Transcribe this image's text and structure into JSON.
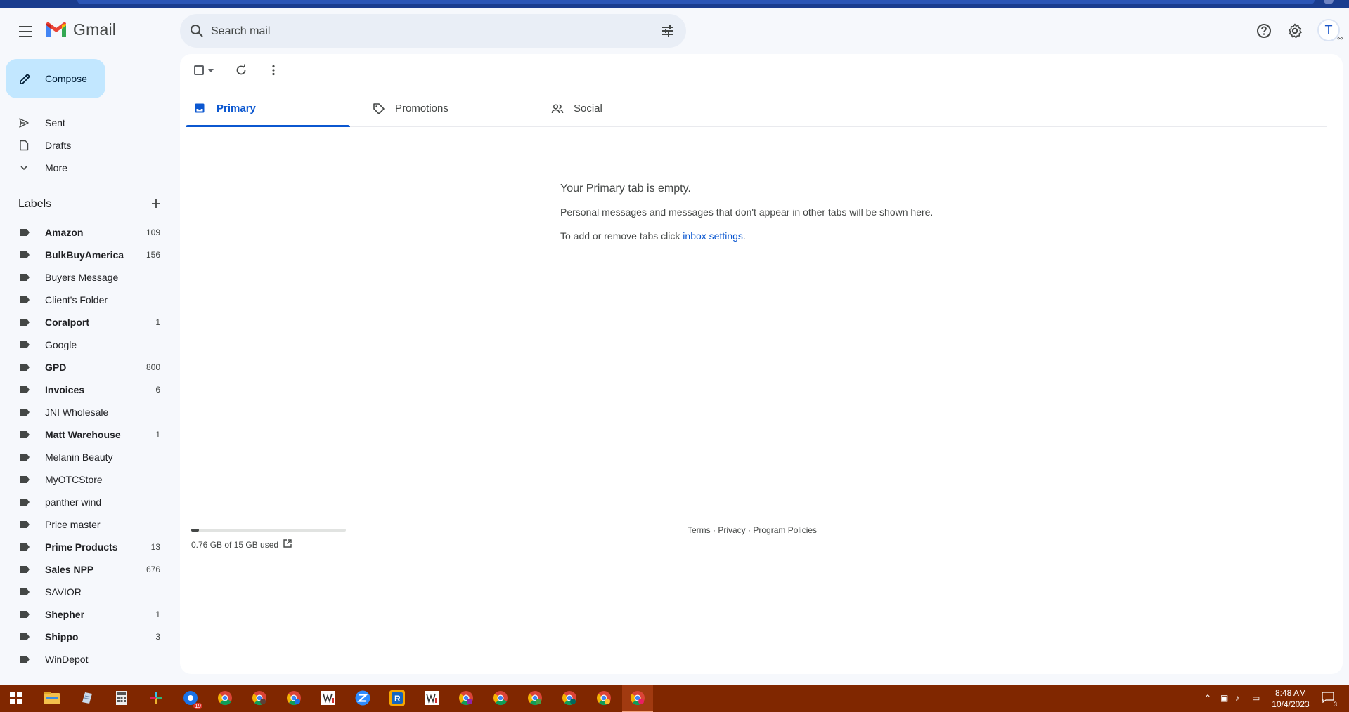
{
  "app": {
    "name": "Gmail",
    "search_placeholder": "Search mail",
    "avatar_initial": "T"
  },
  "sidebar": {
    "compose_label": "Compose",
    "nav": [
      {
        "label": "Sent",
        "icon": "send-icon"
      },
      {
        "label": "Drafts",
        "icon": "draft-icon"
      },
      {
        "label": "More",
        "icon": "chevron-down-icon"
      }
    ],
    "labels_heading": "Labels",
    "labels": [
      {
        "name": "Amazon",
        "count": "109",
        "bold": true
      },
      {
        "name": "BulkBuyAmerica",
        "count": "156",
        "bold": true
      },
      {
        "name": "Buyers Message",
        "count": "",
        "bold": false
      },
      {
        "name": "Client's Folder",
        "count": "",
        "bold": false
      },
      {
        "name": "Coralport",
        "count": "1",
        "bold": true
      },
      {
        "name": "Google",
        "count": "",
        "bold": false
      },
      {
        "name": "GPD",
        "count": "800",
        "bold": true
      },
      {
        "name": "Invoices",
        "count": "6",
        "bold": true
      },
      {
        "name": "JNI Wholesale",
        "count": "",
        "bold": false
      },
      {
        "name": "Matt Warehouse",
        "count": "1",
        "bold": true
      },
      {
        "name": "Melanin Beauty",
        "count": "",
        "bold": false
      },
      {
        "name": "MyOTCStore",
        "count": "",
        "bold": false
      },
      {
        "name": "panther wind",
        "count": "",
        "bold": false
      },
      {
        "name": "Price master",
        "count": "",
        "bold": false
      },
      {
        "name": "Prime Products",
        "count": "13",
        "bold": true
      },
      {
        "name": "Sales NPP",
        "count": "676",
        "bold": true
      },
      {
        "name": "SAVIOR",
        "count": "",
        "bold": false
      },
      {
        "name": "Shepher",
        "count": "1",
        "bold": true
      },
      {
        "name": "Shippo",
        "count": "3",
        "bold": true
      },
      {
        "name": "WinDepot",
        "count": "",
        "bold": false
      }
    ]
  },
  "tabs": [
    {
      "label": "Primary",
      "icon": "inbox-icon",
      "active": true
    },
    {
      "label": "Promotions",
      "icon": "tag-icon",
      "active": false
    },
    {
      "label": "Social",
      "icon": "people-icon",
      "active": false
    }
  ],
  "empty_state": {
    "title": "Your Primary tab is empty.",
    "description": "Personal messages and messages that don't appear in other tabs will be shown here.",
    "hint_prefix": "To add or remove tabs click ",
    "hint_link": "inbox settings",
    "hint_suffix": "."
  },
  "storage": {
    "text": "0.76 GB of 15 GB used",
    "used_fraction": 0.05
  },
  "footer": {
    "terms": "Terms",
    "privacy": "Privacy",
    "policies": "Program Policies",
    "separator": " · "
  },
  "taskbar": {
    "time": "8:48 AM",
    "date": "10/4/2023",
    "notification_count": "3",
    "apps": [
      "windows-start-icon",
      "file-explorer-icon",
      "notepad-icon",
      "calculator-icon",
      "slack-icon",
      "chrome-badge-icon",
      "chrome-icon",
      "chrome-profile-icon",
      "chrome-k-icon",
      "wl-icon",
      "zoom-icon",
      "r-app-icon",
      "wl2-icon",
      "chrome-icon-2",
      "chrome-icon-3",
      "chrome-icon-4",
      "chrome-icon-5",
      "chrome-icon-6",
      "chrome-active-icon"
    ],
    "badge_19": "19"
  },
  "colors": {
    "accent": "#0b57d0",
    "compose_bg": "#c2e7ff",
    "taskbar_bg": "#802700",
    "page_bg": "#f6f8fc"
  }
}
